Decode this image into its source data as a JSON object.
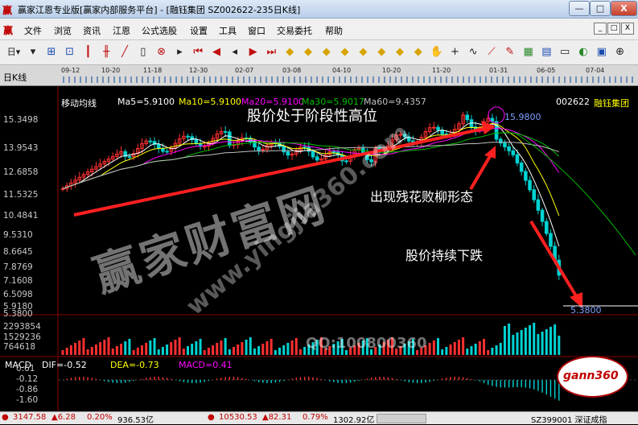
{
  "window": {
    "logo": "赢",
    "title": "赢家江恩专业版[赢家内部服务平台] - [融钰集团  SZ002622-235日K线]",
    "buttons": {
      "minimize": "—",
      "maximize": "□",
      "close": "X"
    }
  },
  "menu": {
    "logo": "赢",
    "items": [
      "文件",
      "浏览",
      "资讯",
      "江恩",
      "公式选股",
      "设置",
      "工具",
      "窗口",
      "交易委托",
      "帮助"
    ],
    "mdi": [
      "_",
      "□",
      "X"
    ]
  },
  "toolbar": {
    "period_selector": "日▾",
    "icons": [
      {
        "name": "period-dropdown-icon",
        "glyph": "▾",
        "cls": "blk"
      },
      {
        "name": "chart-type-icon",
        "glyph": "⊞",
        "cls": "blu"
      },
      {
        "name": "indicator-icon",
        "glyph": "⊡",
        "cls": "blu"
      },
      {
        "name": "kline-icon",
        "glyph": "┃",
        "cls": "red"
      },
      {
        "name": "bar-icon",
        "glyph": "╫",
        "cls": "red"
      },
      {
        "name": "line-icon",
        "glyph": "╱",
        "cls": "red"
      },
      {
        "name": "candle-icon",
        "glyph": "▯",
        "cls": "blk"
      },
      {
        "name": "indicator-icon-2",
        "glyph": "⊗",
        "cls": "red"
      },
      {
        "name": "move-left-icon",
        "glyph": "▸",
        "cls": "blk"
      },
      {
        "name": "first-icon",
        "glyph": "⏮",
        "cls": "red"
      },
      {
        "name": "prev-icon",
        "glyph": "◀",
        "cls": "red"
      },
      {
        "name": "left-icon",
        "glyph": "◂",
        "cls": "blk"
      },
      {
        "name": "next-icon",
        "glyph": "▶",
        "cls": "red"
      },
      {
        "name": "last-icon",
        "glyph": "⏭",
        "cls": "red"
      },
      {
        "name": "gann-diamond-icon",
        "glyph": "◆",
        "cls": "yel"
      },
      {
        "name": "gann-diamond-icon-2",
        "glyph": "◆",
        "cls": "yel"
      },
      {
        "name": "gann-diamond-icon-3",
        "glyph": "◆",
        "cls": "yel"
      },
      {
        "name": "gann-diamond-icon-4",
        "glyph": "◆",
        "cls": "yel"
      },
      {
        "name": "gann-diamond-icon-5",
        "glyph": "◆",
        "cls": "yel"
      },
      {
        "name": "gann-diamond-icon-6",
        "glyph": "◆",
        "cls": "yel"
      },
      {
        "name": "gann-diamond-icon-7",
        "glyph": "◆",
        "cls": "yel"
      },
      {
        "name": "gann-diamond-icon-8",
        "glyph": "◆",
        "cls": "yel"
      },
      {
        "name": "hand-icon",
        "glyph": "✋",
        "cls": "blk"
      },
      {
        "name": "crosshair-icon",
        "glyph": "+",
        "cls": "blk"
      },
      {
        "name": "wave-icon",
        "glyph": "∿",
        "cls": "blk"
      },
      {
        "name": "trend-icon",
        "glyph": "⟋",
        "cls": "red"
      },
      {
        "name": "draw-icon",
        "glyph": "✎",
        "cls": "red"
      },
      {
        "name": "calendar-icon",
        "glyph": "▦",
        "cls": "grn"
      },
      {
        "name": "grid-icon",
        "glyph": "▤",
        "cls": "blu"
      },
      {
        "name": "window-icon",
        "glyph": "▭",
        "cls": "blk"
      },
      {
        "name": "refresh-icon",
        "glyph": "◐",
        "cls": "grn"
      },
      {
        "name": "window-icon-2",
        "glyph": "▣",
        "cls": "blu"
      },
      {
        "name": "zoom-icon",
        "glyph": "⊕",
        "cls": "blk"
      }
    ]
  },
  "datebar": {
    "tab": "日K线",
    "dates": [
      "09-12",
      "10-20",
      "11-18",
      "12-30",
      "02-07",
      "03-08",
      "04-10",
      "10-20",
      "11-20",
      "01-31",
      "06-05",
      "07-04"
    ]
  },
  "info": {
    "indicator": "移动均线",
    "ma5": "Ma5=5.9100",
    "ma10": "Ma10=5.9100",
    "ma20": "Ma20=5.9100",
    "ma30": "Ma30=5.9017",
    "ma60": "Ma60=9.4357",
    "code": "002622",
    "name": "融钰集团"
  },
  "colors": {
    "ma5": "#ffffff",
    "ma10": "#ffff00",
    "ma20": "#ff00ff",
    "ma30": "#00c000",
    "ma60": "#c0c0c0",
    "up": "#ff3030",
    "down": "#00d2d2",
    "annotation": "#ff2020",
    "watermark": "#ffffff"
  },
  "price_axis": [
    "15.3498",
    "13.9543",
    "12.6858",
    "11.5325",
    "10.4841",
    "9.5310",
    "8.6645",
    "7.8769",
    "7.1608",
    "6.5098",
    "5.9180",
    "5.3800"
  ],
  "volume_axis": [
    "2293854",
    "1529236",
    "764618"
  ],
  "macd_axis": [
    "0.61",
    "-0.12",
    "-0.86",
    "-1.60"
  ],
  "macd_info": {
    "title": "MACD",
    "dif": "DIF=-0.52",
    "dea": "DEA=-0.73",
    "macd": "MACD=0.41"
  },
  "chart_labels": {
    "high_label": "15.9800",
    "low_label": "5.3800"
  },
  "annotations": {
    "high_phase": "股价处于阶段性高位",
    "pattern": "出现残花败柳形态",
    "falling": "股价持续下跌"
  },
  "watermark": {
    "brand": "赢家财富网",
    "site": "www.yingjia360.com",
    "qq": "QQ:100800360",
    "logo": "gann360"
  },
  "bottombar": {
    "idx1_value": "3147.58",
    "idx1_change": "▲6.28",
    "idx1_pct": "0.20%",
    "idx1_vol": "936.53亿",
    "idx2_value": "10530.53",
    "idx2_change": "▲82.31",
    "idx2_pct": "0.79%",
    "idx2_vol": "1302.92亿",
    "idx3": "SZ399001 深证成指"
  }
}
